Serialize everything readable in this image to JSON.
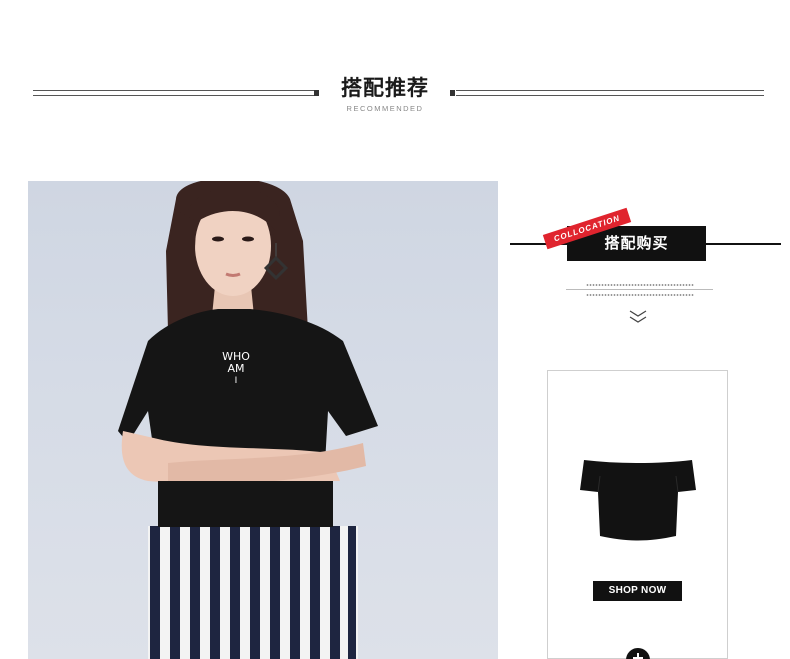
{
  "header": {
    "title": "搭配推荐",
    "subtitle": "RECOMMENDED"
  },
  "photo": {
    "shirt_print": [
      "WHO",
      "AM",
      "I"
    ]
  },
  "side": {
    "tag_label": "搭配购买",
    "ribbon_label": "COLLOCATION",
    "chevron_icon": "double-chevron-down-icon"
  },
  "product": {
    "shop_label": "SHOP NOW",
    "plus_icon": "plus-circle-icon"
  },
  "colors": {
    "accent_red": "#e0242e",
    "black": "#111111"
  }
}
